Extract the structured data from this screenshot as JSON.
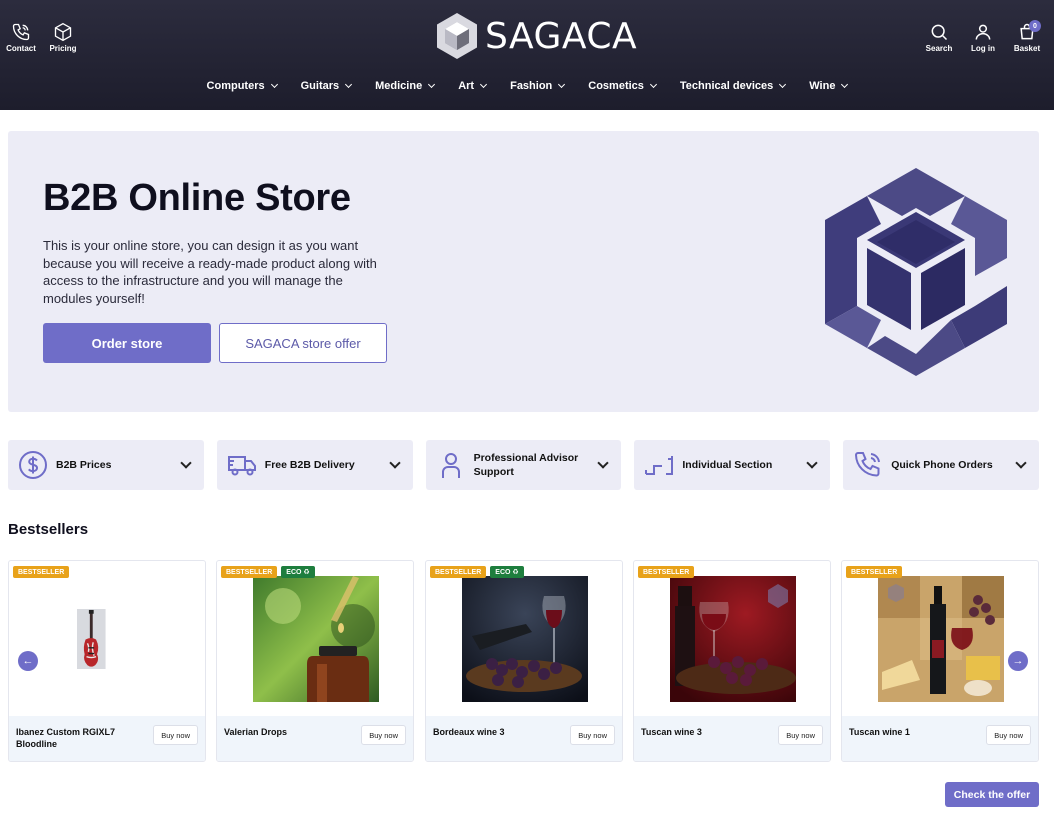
{
  "header": {
    "brand": "SAGACA",
    "left_actions": [
      {
        "label": "Contact",
        "icon": "phone-icon"
      },
      {
        "label": "Pricing",
        "icon": "cube-icon"
      }
    ],
    "right_actions": [
      {
        "label": "Search",
        "icon": "search-icon"
      },
      {
        "label": "Log in",
        "icon": "user-icon"
      },
      {
        "label": "Basket",
        "icon": "basket-icon"
      }
    ],
    "basket_count": "0",
    "nav": [
      {
        "label": "Computers"
      },
      {
        "label": "Guitars"
      },
      {
        "label": "Medicine"
      },
      {
        "label": "Art"
      },
      {
        "label": "Fashion"
      },
      {
        "label": "Cosmetics"
      },
      {
        "label": "Technical devices"
      },
      {
        "label": "Wine"
      }
    ]
  },
  "hero": {
    "title": "B2B Online Store",
    "text": "This is your online store, you can design it as you want because you will receive a ready-made product along with access to the infrastructure and you will manage the modules yourself!",
    "primary_button": "Order store",
    "secondary_button": "SAGACA store offer"
  },
  "features": [
    {
      "label": "B2B Prices",
      "icon": "dollar-icon"
    },
    {
      "label": "Free B2B Delivery",
      "icon": "truck-icon"
    },
    {
      "label": "Professional Advisor Support",
      "icon": "person-icon"
    },
    {
      "label": "Individual Section",
      "icon": "section-icon"
    },
    {
      "label": "Quick Phone Orders",
      "icon": "phone-icon"
    }
  ],
  "bestsellers": {
    "title": "Bestsellers",
    "products": [
      {
        "name": "Ibanez Custom RGIXL7 Bloodline",
        "badges": [
          "BESTSELLER"
        ],
        "buy": "Buy now",
        "image": "guitar"
      },
      {
        "name": "Valerian Drops",
        "badges": [
          "BESTSELLER",
          "ECO"
        ],
        "buy": "Buy now",
        "image": "drops"
      },
      {
        "name": "Bordeaux wine 3",
        "badges": [
          "BESTSELLER",
          "ECO"
        ],
        "buy": "Buy now",
        "image": "wine-dark"
      },
      {
        "name": "Tuscan wine 3",
        "badges": [
          "BESTSELLER"
        ],
        "buy": "Buy now",
        "image": "wine-red"
      },
      {
        "name": "Tuscan wine 1",
        "badges": [
          "BESTSELLER"
        ],
        "buy": "Buy now",
        "image": "wine-cheese"
      }
    ],
    "check_offer": "Check the offer"
  },
  "colors": {
    "header_bg": "#23232f",
    "accent": "#6f6dc8",
    "hero_bg": "#ececf6",
    "bestseller_badge": "#e8a21a",
    "eco_badge": "#1e7e3e"
  }
}
